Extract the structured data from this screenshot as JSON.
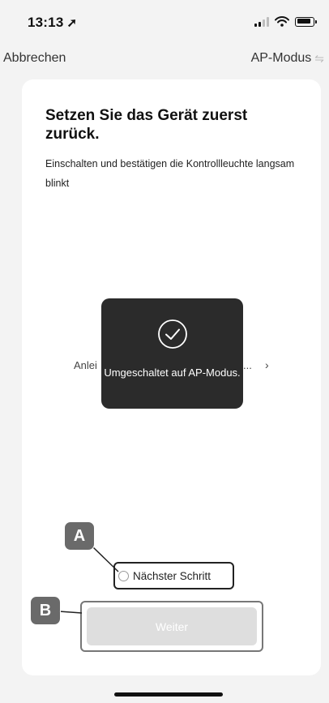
{
  "status_bar": {
    "time": "13:13",
    "location_icon": "location-arrow-icon",
    "icons": [
      "signal-icon",
      "wifi-icon",
      "battery-icon"
    ]
  },
  "nav": {
    "cancel_label": "Abbrechen",
    "mode_label": "AP-Modus",
    "mode_icon": "swap-icon"
  },
  "content": {
    "title": "Setzen Sie das Gerät zuerst zurück.",
    "subtitle": "Einschalten und bestätigen die Kontrollleuchte langsam blinkt",
    "guide_link_visible": "Anlei",
    "guide_link_ellipsis": "...",
    "guide_chevron": "›"
  },
  "toast": {
    "icon": "check-circle-icon",
    "text": "Umgeschaltet auf AP-Modus."
  },
  "next_step": {
    "label": "Nächster Schritt",
    "checked": false
  },
  "weiter_button": {
    "label": "Weiter",
    "enabled": false
  },
  "callouts": {
    "a": "A",
    "b": "B"
  },
  "colors": {
    "page_background": "#f3f3f3",
    "card_background": "#ffffff",
    "toast_background": "#2b2b2b",
    "disabled_button": "#dedede",
    "callout_badge": "#6a6a6a"
  }
}
